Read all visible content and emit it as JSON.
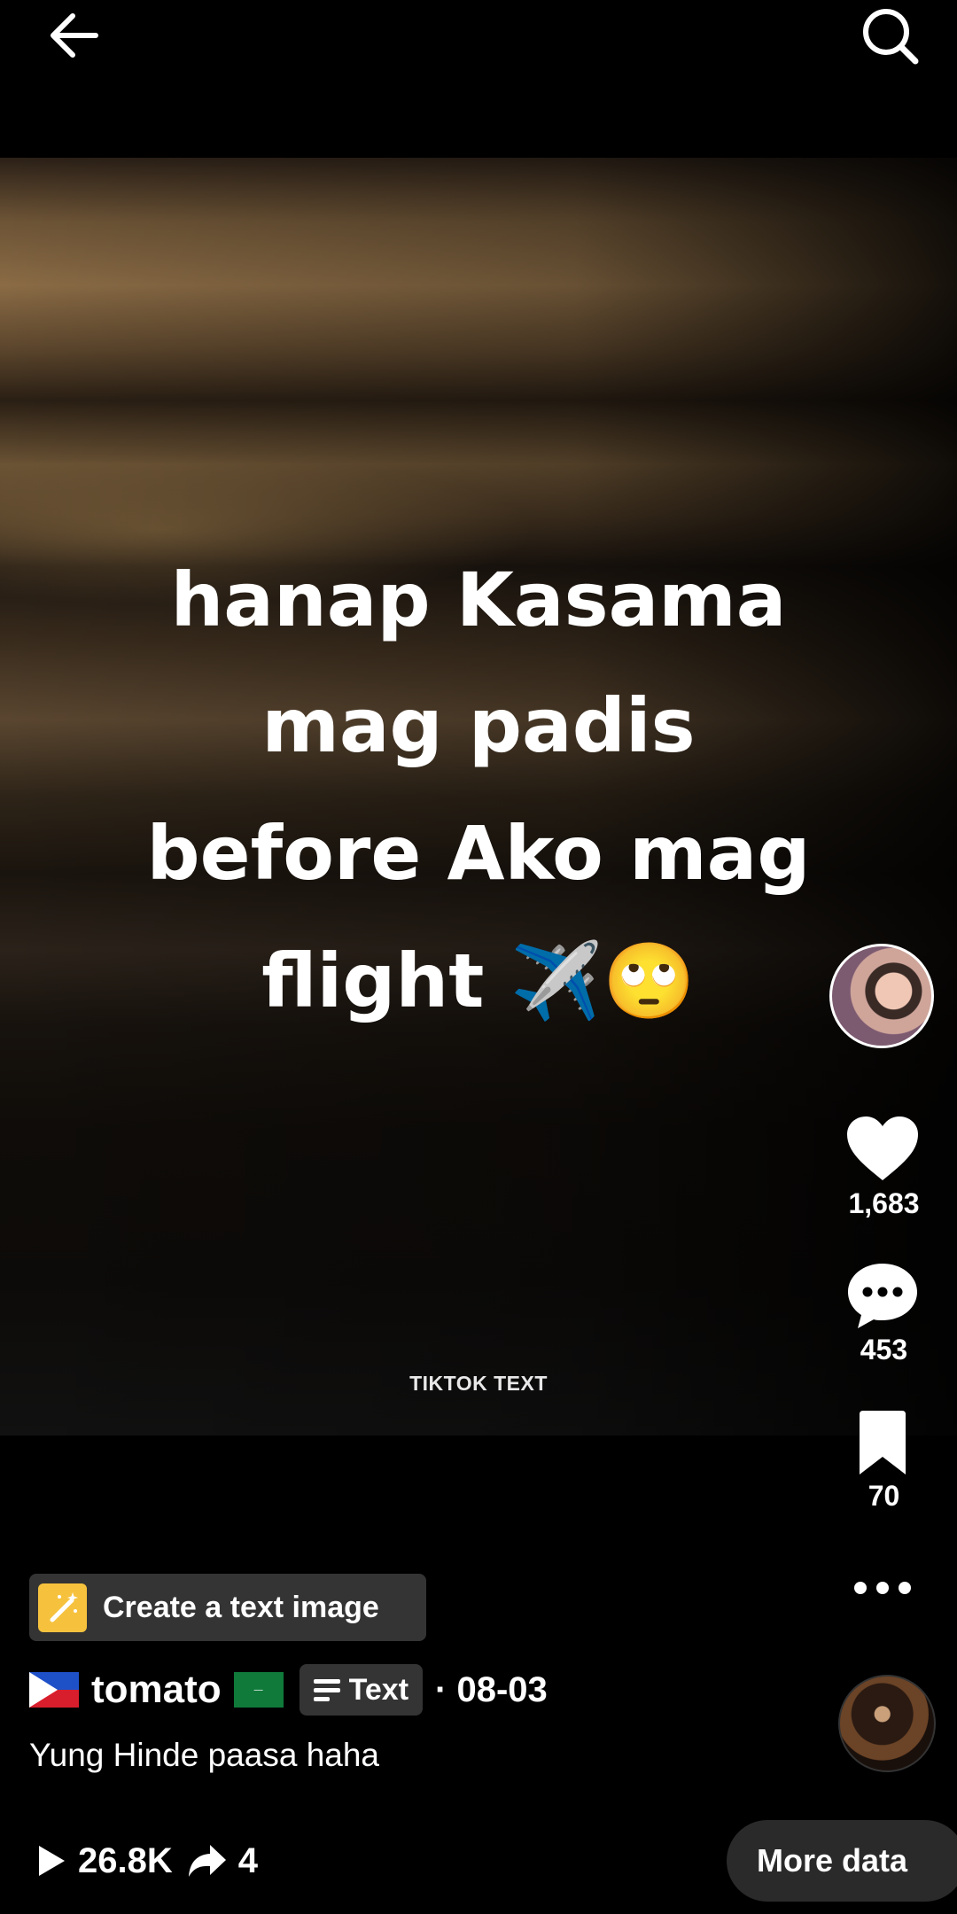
{
  "video": {
    "caption_lines": [
      "hanap Kasama",
      "mag padis",
      "before Ako mag",
      "flight ✈️🙄"
    ],
    "watermark": "TIKTOK TEXT"
  },
  "actions": {
    "likes": "1,683",
    "comments": "453",
    "favorites": "70"
  },
  "create_chip": {
    "label": "Create a text image"
  },
  "author": {
    "name": "tomato",
    "flag_left": "🇵🇭",
    "flag_right": "🇸🇦",
    "type_label": "Text",
    "date": "· 08-03"
  },
  "description": "Yung Hinde paasa haha",
  "stats": {
    "plays": "26.8K",
    "shares": "4"
  },
  "more_data_label": "More data",
  "colors": {
    "background": "#000000",
    "chip_icon": "#f6c23e",
    "button_bg": "#2a2a2a"
  }
}
